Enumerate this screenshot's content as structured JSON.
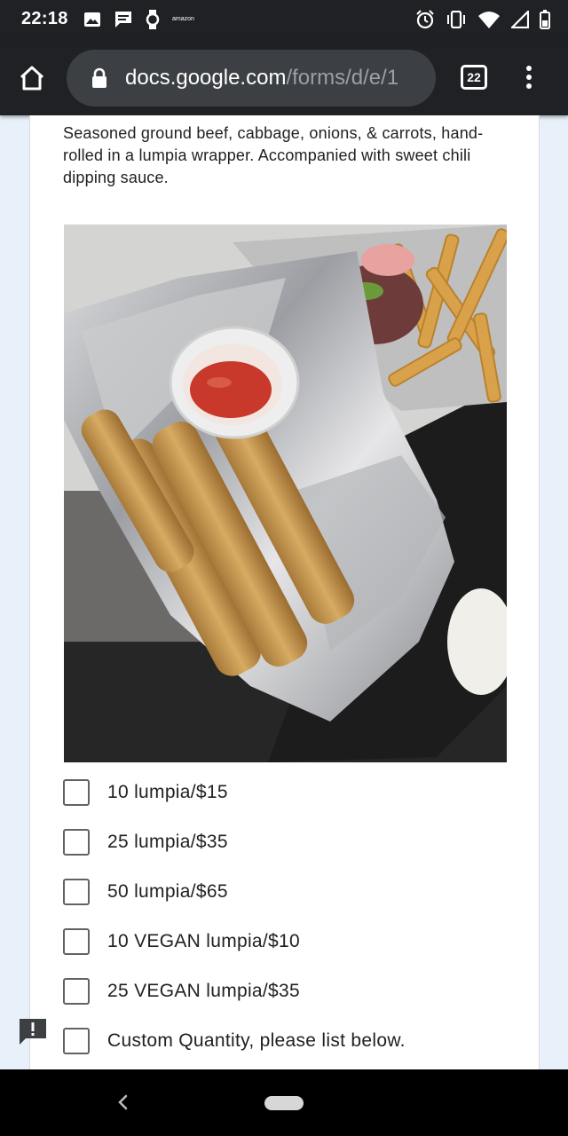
{
  "status_bar": {
    "time": "22:18",
    "left_icons": [
      "image-icon",
      "message-icon",
      "watch-icon",
      "amazon-icon"
    ],
    "amazon_label": "amazon",
    "right_icons": [
      "alarm-icon",
      "vibrate-icon",
      "wifi-icon",
      "signal-icon",
      "battery-icon"
    ]
  },
  "browser": {
    "url_domain": "docs.google.com",
    "url_path": "/forms/d/e/1",
    "tab_count": "22"
  },
  "form": {
    "description": "Seasoned ground beef, cabbage, onions, & carrots, hand-rolled in a lumpia wrapper. Accompanied with sweet chili dipping sauce.",
    "options": [
      {
        "label": "10 lumpia/$15",
        "checked": false
      },
      {
        "label": "25 lumpia/$35",
        "checked": false
      },
      {
        "label": "50 lumpia/$65",
        "checked": false
      },
      {
        "label": "10 VEGAN lumpia/$10",
        "checked": false
      },
      {
        "label": "25 VEGAN lumpia/$35",
        "checked": false
      },
      {
        "label": "Custom Quantity, please list below.",
        "checked": false
      }
    ]
  },
  "colors": {
    "page_background": "#e8f0fa",
    "toolbar": "#202124",
    "text": "#202124",
    "checkbox_border": "#5f6368"
  }
}
